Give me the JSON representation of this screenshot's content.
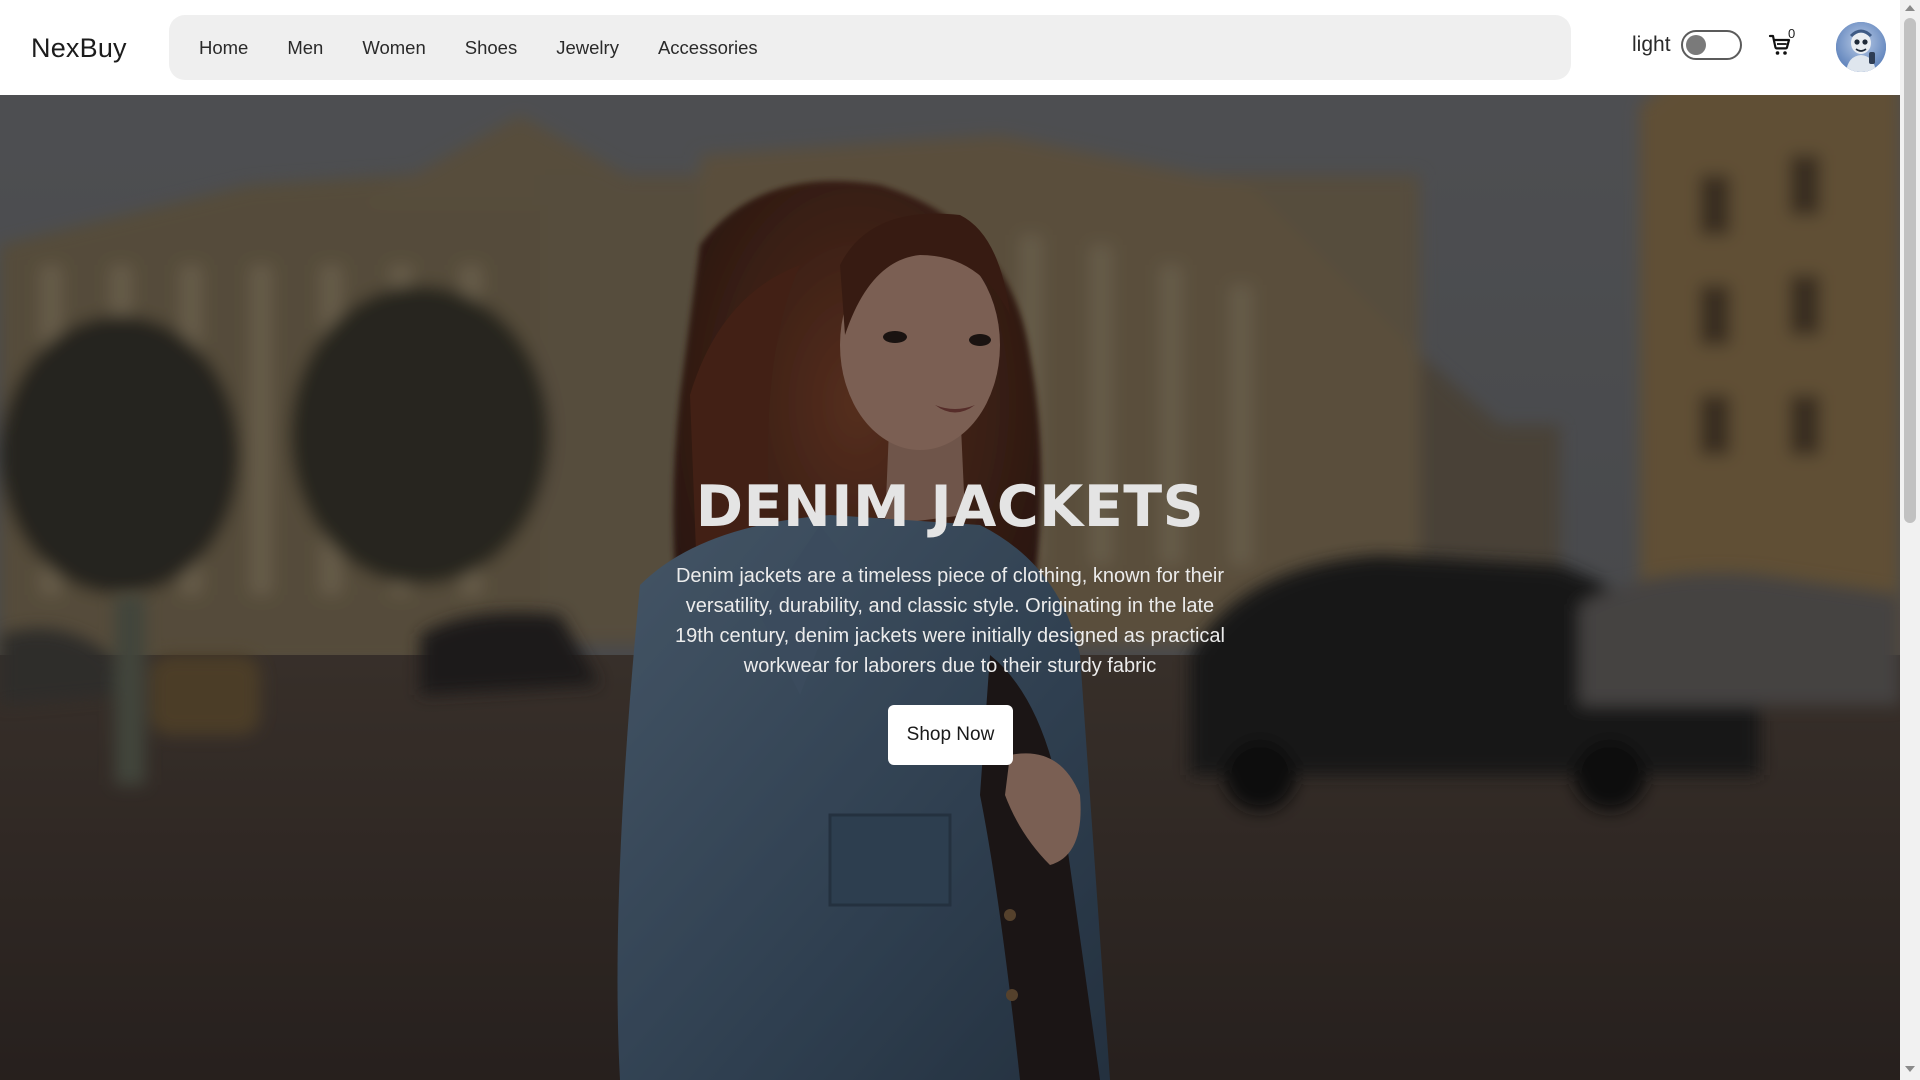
{
  "header": {
    "logo": "NexBuy",
    "nav": [
      {
        "label": "Home"
      },
      {
        "label": "Men"
      },
      {
        "label": "Women"
      },
      {
        "label": "Shoes"
      },
      {
        "label": "Jewelry"
      },
      {
        "label": "Accessories"
      }
    ],
    "theme_label": "light",
    "theme_toggle_on": false,
    "cart_count": "0"
  },
  "hero": {
    "title": "DENIM JACKETS",
    "description": "Denim jackets are a timeless piece of clothing, known for their versatility, durability, and classic style. Originating in the late 19th century, denim jackets were initially designed as practical workwear for laborers due to their sturdy fabric",
    "button_label": "Shop Now"
  },
  "icons": {
    "cart": "shopping-cart-icon",
    "avatar": "user-avatar"
  },
  "colors": {
    "nav_background": "#efefef",
    "hero_title": "#e4e4e4",
    "button_background": "#ffffff"
  }
}
